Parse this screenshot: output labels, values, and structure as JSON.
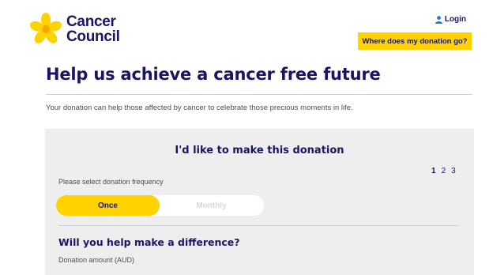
{
  "brand": {
    "name_line1": "Cancer",
    "name_line2": "Council",
    "logo_color": "#ffd200",
    "text_color": "#1b1464"
  },
  "header": {
    "login_label": "Login",
    "login_icon": "user-icon",
    "donation_button_label": "Where does my donation go?"
  },
  "page": {
    "title": "Help us achieve a cancer free future",
    "intro": "Your donation can help those affected by cancer to celebrate those precious moments in life."
  },
  "donation_panel": {
    "title": "I'd like to make this donation",
    "steps": [
      "1",
      "2",
      "3"
    ],
    "current_step": "1",
    "frequency_label": "Please select donation frequency",
    "frequency_options": [
      "Once",
      "Monthly"
    ],
    "selected_frequency": "Once",
    "difference_title": "Will you help make a difference?",
    "amount_label": "Donation amount (AUD)"
  },
  "colors": {
    "accent": "#ffd200",
    "navy": "#1b1464",
    "panel_bg": "#eeeeee"
  }
}
